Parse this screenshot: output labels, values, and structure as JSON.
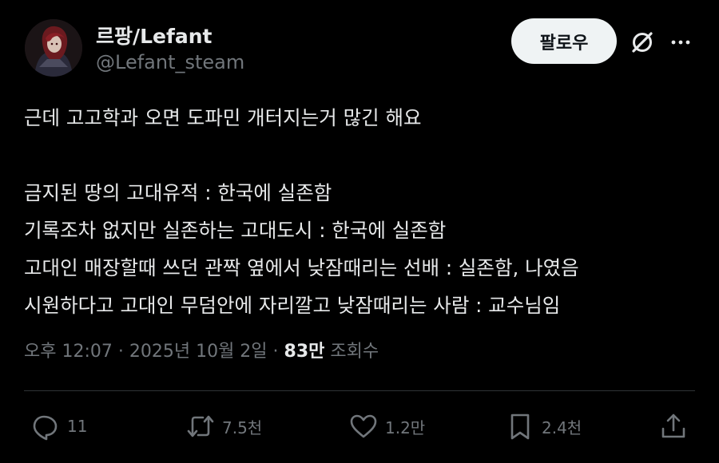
{
  "author": {
    "display_name": "르팡/Lefant",
    "handle": "@Lefant_steam"
  },
  "header": {
    "follow_label": "팔로우",
    "icons": [
      "grok-icon",
      "more-icon"
    ]
  },
  "tweet": {
    "lines": [
      "근데 고고학과 오면 도파민 개터지는거 많긴 해요",
      "",
      "금지된 땅의 고대유적 : 한국에 실존함",
      "기록조차 없지만 실존하는 고대도시 : 한국에 실존함",
      "고대인 매장할때 쓰던 관짝 옆에서 낮잠때리는 선배 : 실존함, 나였음",
      "시원하다고 고대인 무덤안에 자리깔고 낮잠때리는 사람 : 교수님임"
    ]
  },
  "meta": {
    "time": "오후 12:07",
    "separator": " · ",
    "date": "2025년 10월 2일",
    "views_count": "83만",
    "views_label": "조회수"
  },
  "actions": {
    "reply_count": "11",
    "retweet_count": "7.5천",
    "like_count": "1.2만",
    "bookmark_count": "2.4천",
    "icons": [
      "reply-icon",
      "retweet-icon",
      "like-icon",
      "bookmark-icon",
      "share-icon"
    ]
  },
  "colors": {
    "background": "#000000",
    "text": "#e7e9ea",
    "muted": "#71767b",
    "follow_button": "#eff3f4",
    "divider": "#2f3336"
  }
}
